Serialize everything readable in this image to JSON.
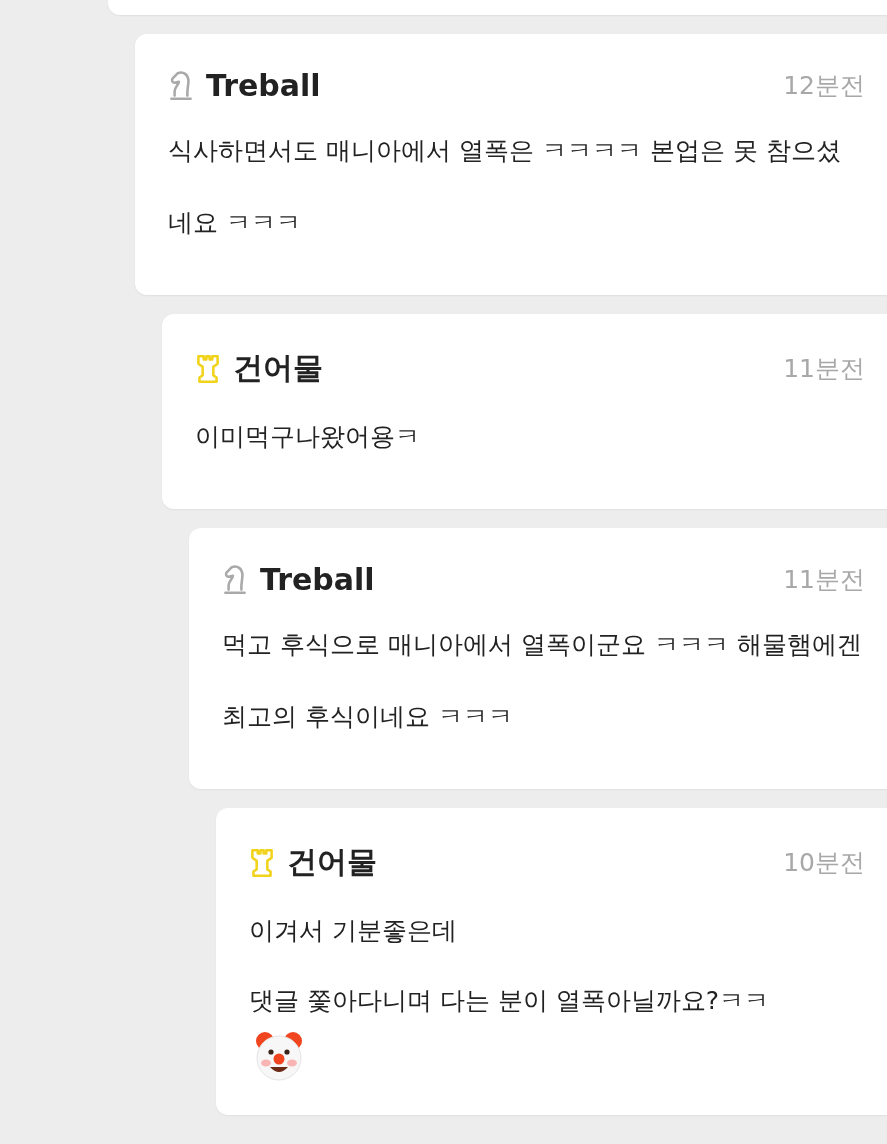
{
  "comments": [
    {
      "author": "Treball",
      "kind": "knight",
      "time": "12분전",
      "paragraphs": [
        {
          "kind": "text",
          "text": "식사하면서도 매니아에서 열폭은 ㅋㅋㅋㅋ 본업은 못 참으셨네요 ㅋㅋㅋ"
        }
      ]
    },
    {
      "author": "건어물",
      "kind": "rook",
      "time": "11분전",
      "paragraphs": [
        {
          "kind": "text",
          "text": "이미먹구나왔어용ㅋ"
        }
      ]
    },
    {
      "author": "Treball",
      "kind": "knight",
      "time": "11분전",
      "paragraphs": [
        {
          "kind": "text",
          "text": "먹고 후식으로 매니아에서 열폭이군요 ㅋㅋㅋ 해물햄에겐 최고의 후식이네요 ㅋㅋㅋ"
        }
      ]
    },
    {
      "author": "건어물",
      "kind": "rook",
      "time": "10분전",
      "paragraphs": [
        {
          "kind": "text",
          "text": "이겨서 기분좋은데"
        },
        {
          "kind": "text",
          "text": "댓글 쫓아다니며 다는 분이 열폭아닐까요?ㅋㅋ"
        },
        {
          "kind": "clown"
        }
      ]
    }
  ]
}
